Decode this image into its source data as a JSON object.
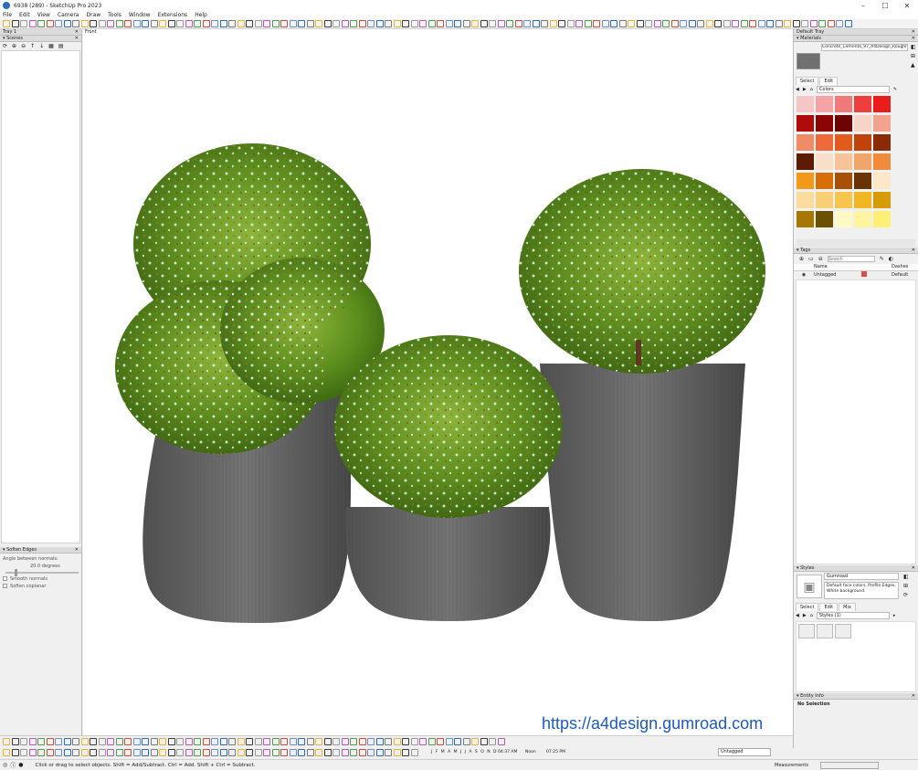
{
  "window": {
    "title": "6938 (289) - SketchUp Pro 2023",
    "controls": [
      "–",
      "☐",
      "✕"
    ]
  },
  "menu": [
    "File",
    "Edit",
    "View",
    "Camera",
    "Draw",
    "Tools",
    "Window",
    "Extensions",
    "Help"
  ],
  "left_tray": {
    "title": "Tray 1",
    "scenes_title": "Scenes",
    "soften": {
      "title": "Soften Edges",
      "angle_label": "Angle between normals:",
      "angle_value": "20.0  degrees",
      "smooth_label": "Smooth normals",
      "coplanar_label": "Soften coplanar"
    }
  },
  "viewport": {
    "view_label": "Front",
    "watermark": "https://a4design.gumroad.com"
  },
  "right_tray": {
    "title": "Default Tray",
    "materials": {
      "title": "Materials",
      "current_name": "Concrete_Cemento_97_A4Design_Roughness_Fil",
      "tab_select": "Select",
      "tab_edit": "Edit",
      "library": "Colors",
      "swatches": [
        "#f5c6c6",
        "#f4a4a4",
        "#f07a7a",
        "#ee3e3e",
        "#ea1c1c",
        "#b00b0b",
        "#8c0505",
        "#6d0404",
        "#f8d4c8",
        "#f2a38e",
        "#ef8b67",
        "#ee6a3b",
        "#e25a1c",
        "#c0440a",
        "#8a2b06",
        "#5e1b03",
        "#fadfc8",
        "#f7c49a",
        "#f2a56b",
        "#ef8b3a",
        "#f29a17",
        "#d86f06",
        "#a85106",
        "#6a3304",
        "#fce7c6",
        "#fbdc9e",
        "#f8ce77",
        "#f7c44e",
        "#f2b623",
        "#d79b07",
        "#a67703",
        "#6d4f02",
        "#fff9c5",
        "#fff59f",
        "#fff074"
      ]
    },
    "tags": {
      "title": "Tags",
      "search_placeholder": "Search",
      "col_name": "Name",
      "col_dashes": "Dashes",
      "rows": [
        {
          "name": "Untagged",
          "color": "#e04a4a",
          "dashes": "Default"
        }
      ]
    },
    "styles": {
      "title": "Styles",
      "name": "Gumroad",
      "description": "Default face colors. Profile Edges. White background.",
      "tab_select": "Select",
      "tab_edit": "Edit",
      "tab_mix": "Mix",
      "library": "Styles (1)"
    },
    "entity_info": {
      "title": "Entity Info",
      "value": "No Selection"
    }
  },
  "shadows": {
    "months": "J F M A M J J A S O N D",
    "time_start": "04:37 AM",
    "time_mid": "Noon",
    "time_end": "07:25 PM"
  },
  "status": {
    "hint": "Click or drag to select objects. Shift = Add/Subtract. Ctrl = Add. Shift + Ctrl = Subtract.",
    "tag": "Untagged",
    "measurements_label": "Measurements"
  }
}
